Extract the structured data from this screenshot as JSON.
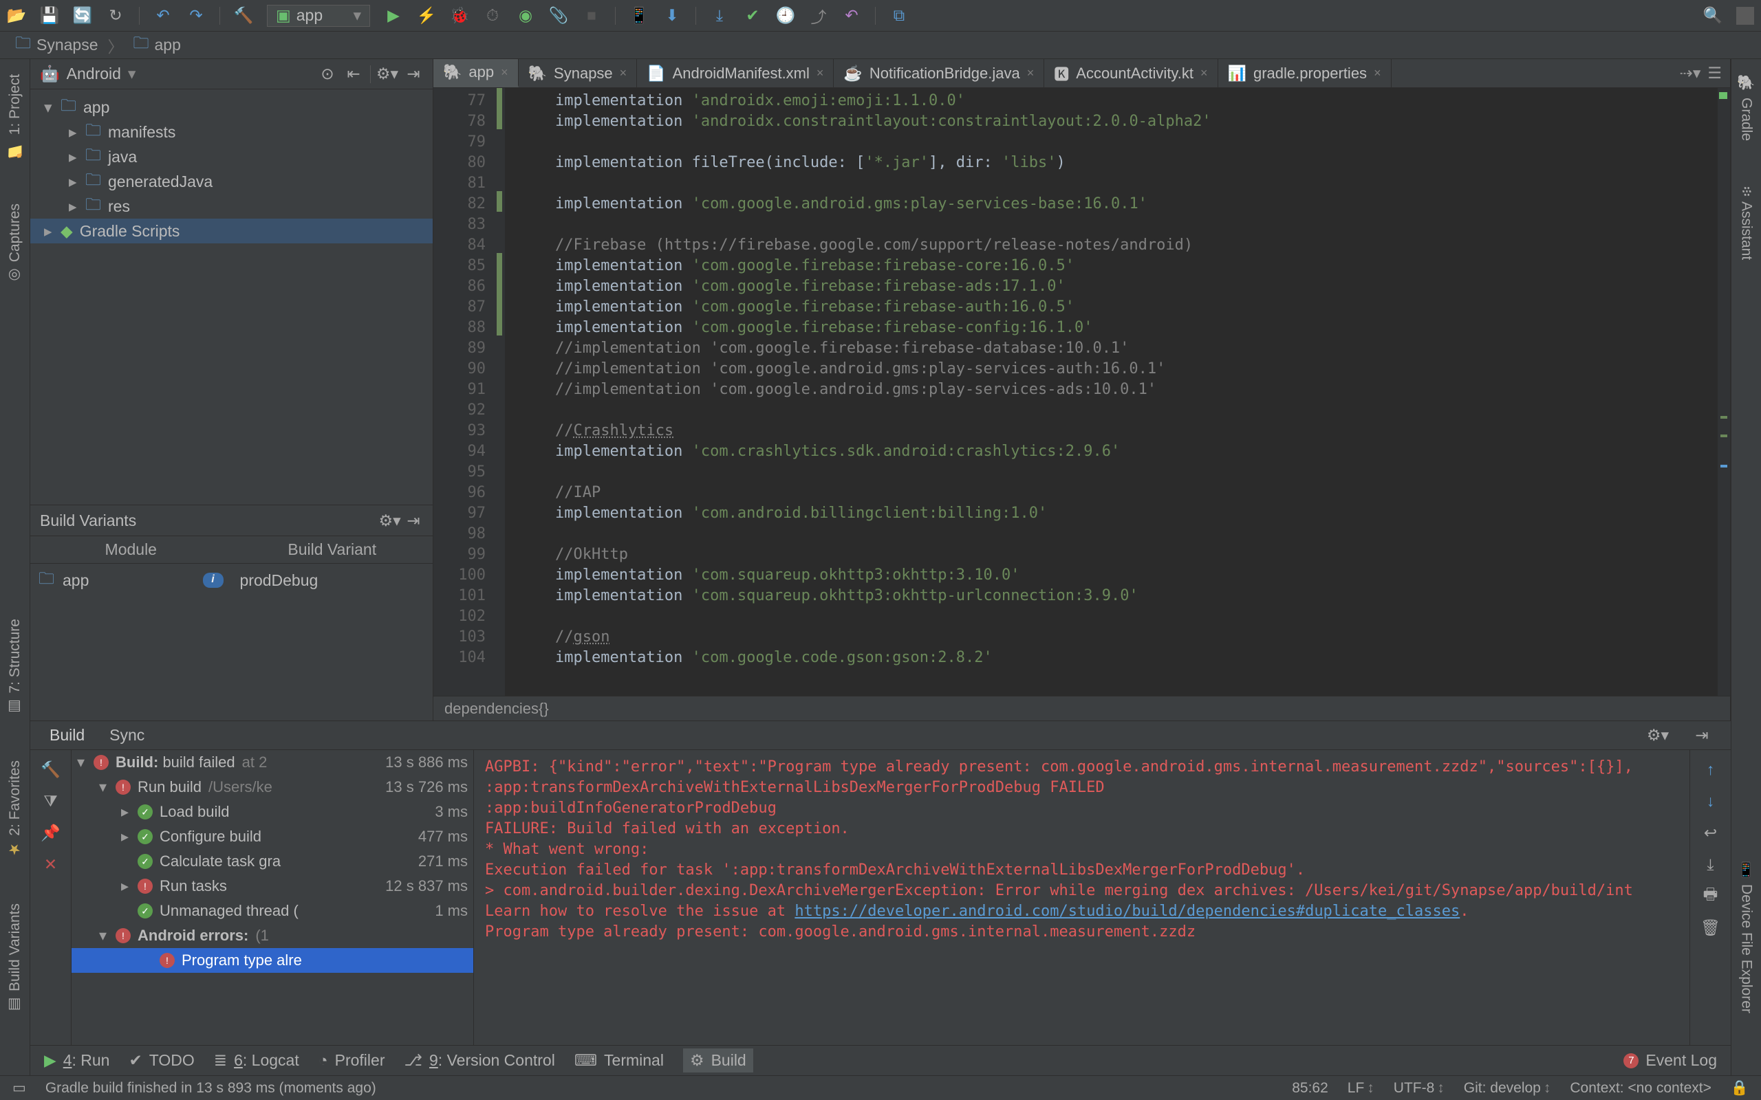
{
  "toolbar": {
    "run_config": "app"
  },
  "breadcrumb": [
    {
      "icon": "folder",
      "label": "Synapse"
    },
    {
      "icon": "folder",
      "label": "app"
    }
  ],
  "left_tools": [
    {
      "label": "1: Project"
    },
    {
      "label": "Captures"
    },
    {
      "label": "7: Structure"
    },
    {
      "label": "2: Favorites"
    },
    {
      "label": "Build Variants"
    }
  ],
  "right_tools": [
    {
      "label": "Gradle"
    },
    {
      "label": "Assistant"
    },
    {
      "label": "Device File Explorer"
    }
  ],
  "project": {
    "mode": "Android",
    "tree": [
      {
        "depth": 0,
        "label": "app",
        "icon": "module",
        "expand": "down"
      },
      {
        "depth": 1,
        "label": "manifests",
        "icon": "folder",
        "expand": "right"
      },
      {
        "depth": 1,
        "label": "java",
        "icon": "folder",
        "expand": "right"
      },
      {
        "depth": 1,
        "label": "generatedJava",
        "icon": "folder",
        "expand": "right"
      },
      {
        "depth": 1,
        "label": "res",
        "icon": "folder",
        "expand": "right"
      },
      {
        "depth": 0,
        "label": "Gradle Scripts",
        "icon": "gradle",
        "expand": "right",
        "selected": true
      }
    ]
  },
  "build_variants": {
    "title": "Build Variants",
    "cols": [
      "Module",
      "Build Variant"
    ],
    "rows": [
      {
        "module": "app",
        "variant": "prodDebug"
      }
    ]
  },
  "editor": {
    "tabs": [
      {
        "label": "app",
        "icon": "gradle",
        "active": true
      },
      {
        "label": "Synapse",
        "icon": "gradle"
      },
      {
        "label": "AndroidManifest.xml",
        "icon": "xml"
      },
      {
        "label": "NotificationBridge.java",
        "icon": "java"
      },
      {
        "label": "AccountActivity.kt",
        "icon": "kt"
      },
      {
        "label": "gradle.properties",
        "icon": "props"
      }
    ],
    "first_line": 77,
    "lines": [
      {
        "t": "s",
        "text": "    implementation 'androidx.emoji:emoji:1.1.0.0'"
      },
      {
        "t": "s",
        "text": "    implementation 'androidx.constraintlayout:constraintlayout:2.0.0-alpha2'"
      },
      {
        "t": "b",
        "text": ""
      },
      {
        "t": "p",
        "text": "    implementation fileTree(include: ['*.jar'], dir: 'libs')"
      },
      {
        "t": "b",
        "text": ""
      },
      {
        "t": "s",
        "text": "    implementation 'com.google.android.gms:play-services-base:16.0.1'"
      },
      {
        "t": "b",
        "text": ""
      },
      {
        "t": "c",
        "text": "    //Firebase (https://firebase.google.com/support/release-notes/android)"
      },
      {
        "t": "s",
        "text": "    implementation 'com.google.firebase:firebase-core:16.0.5'"
      },
      {
        "t": "s",
        "text": "    implementation 'com.google.firebase:firebase-ads:17.1.0'"
      },
      {
        "t": "s",
        "text": "    implementation 'com.google.firebase:firebase-auth:16.0.5'"
      },
      {
        "t": "s",
        "text": "    implementation 'com.google.firebase:firebase-config:16.1.0'"
      },
      {
        "t": "c",
        "text": "    //implementation 'com.google.firebase:firebase-database:10.0.1'"
      },
      {
        "t": "c",
        "text": "    //implementation 'com.google.android.gms:play-services-auth:16.0.1'"
      },
      {
        "t": "c",
        "text": "    //implementation 'com.google.android.gms:play-services-ads:10.0.1'"
      },
      {
        "t": "b",
        "text": ""
      },
      {
        "t": "cu",
        "text": "    //Crashlytics"
      },
      {
        "t": "s",
        "text": "    implementation 'com.crashlytics.sdk.android:crashlytics:2.9.6'"
      },
      {
        "t": "b",
        "text": ""
      },
      {
        "t": "c",
        "text": "    //IAP"
      },
      {
        "t": "s",
        "text": "    implementation 'com.android.billingclient:billing:1.0'"
      },
      {
        "t": "b",
        "text": ""
      },
      {
        "t": "c",
        "text": "    //OkHttp"
      },
      {
        "t": "s",
        "text": "    implementation 'com.squareup.okhttp3:okhttp:3.10.0'"
      },
      {
        "t": "s",
        "text": "    implementation 'com.squareup.okhttp3:okhttp-urlconnection:3.9.0'"
      },
      {
        "t": "b",
        "text": ""
      },
      {
        "t": "cu",
        "text": "    //gson"
      },
      {
        "t": "s",
        "text": "    implementation 'com.google.code.gson:gson:2.8.2'"
      }
    ],
    "crumb": "dependencies{}"
  },
  "build_panel": {
    "tabs": [
      "Build",
      "Sync"
    ],
    "tree": [
      {
        "i": 0,
        "tw": "down",
        "ic": "er",
        "bold": true,
        "label": "Build:",
        "suffix": " build failed",
        "meta": "at 2",
        "time": "13 s 886 ms"
      },
      {
        "i": 1,
        "tw": "down",
        "ic": "er",
        "label": "Run build",
        "meta": "/Users/ke",
        "time": "13 s 726 ms"
      },
      {
        "i": 2,
        "tw": "right",
        "ic": "ok",
        "label": "Load build",
        "time": "3 ms"
      },
      {
        "i": 2,
        "tw": "right",
        "ic": "ok",
        "label": "Configure build",
        "time": "477 ms"
      },
      {
        "i": 2,
        "tw": "",
        "ic": "ok",
        "label": "Calculate task gra",
        "time": "271 ms"
      },
      {
        "i": 2,
        "tw": "right",
        "ic": "er",
        "label": "Run tasks",
        "time": "12 s 837 ms"
      },
      {
        "i": 2,
        "tw": "",
        "ic": "ok",
        "label": "Unmanaged thread (",
        "time": "1 ms"
      },
      {
        "i": 1,
        "tw": "down",
        "ic": "er",
        "bold": true,
        "label": "Android errors:",
        "meta": "(1"
      },
      {
        "i": 3,
        "tw": "",
        "ic": "er",
        "label": "Program type alre",
        "selected": true
      }
    ],
    "console": [
      "AGPBI: {\"kind\":\"error\",\"text\":\"Program type already present: com.google.android.gms.internal.measurement.zzdz\",\"sources\":[{}],",
      ":app:transformDexArchiveWithExternalLibsDexMergerForProdDebug FAILED",
      ":app:buildInfoGeneratorProdDebug",
      "FAILURE: Build failed with an exception.",
      "* What went wrong:",
      "Execution failed for task ':app:transformDexArchiveWithExternalLibsDexMergerForProdDebug'.",
      "> com.android.builder.dexing.DexArchiveMergerException: Error while merging dex archives: /Users/kei/git/Synapse/app/build/int",
      "  Learn how to resolve the issue at https://developer.android.com/studio/build/dependencies#duplicate_classes.",
      "  Program type already present: com.google.android.gms.internal.measurement.zzdz"
    ],
    "console_link": "https://developer.android.com/studio/build/dependencies#duplicate_classes"
  },
  "bottom": [
    {
      "icon": "run",
      "label": "4: Run"
    },
    {
      "icon": "todo",
      "label": "TODO"
    },
    {
      "icon": "logcat",
      "label": "6: Logcat"
    },
    {
      "icon": "profiler",
      "label": "Profiler"
    },
    {
      "icon": "vcs",
      "label": "9: Version Control"
    },
    {
      "icon": "terminal",
      "label": "Terminal"
    },
    {
      "icon": "build",
      "label": "Build",
      "active": true
    }
  ],
  "event_log": {
    "count": "7",
    "label": "Event Log"
  },
  "status": {
    "msg": "Gradle build finished in 13 s 893 ms (moments ago)",
    "caret": "85:62",
    "le": "LF",
    "enc": "UTF-8",
    "git": "Git: develop",
    "ctx": "Context: <no context>"
  }
}
